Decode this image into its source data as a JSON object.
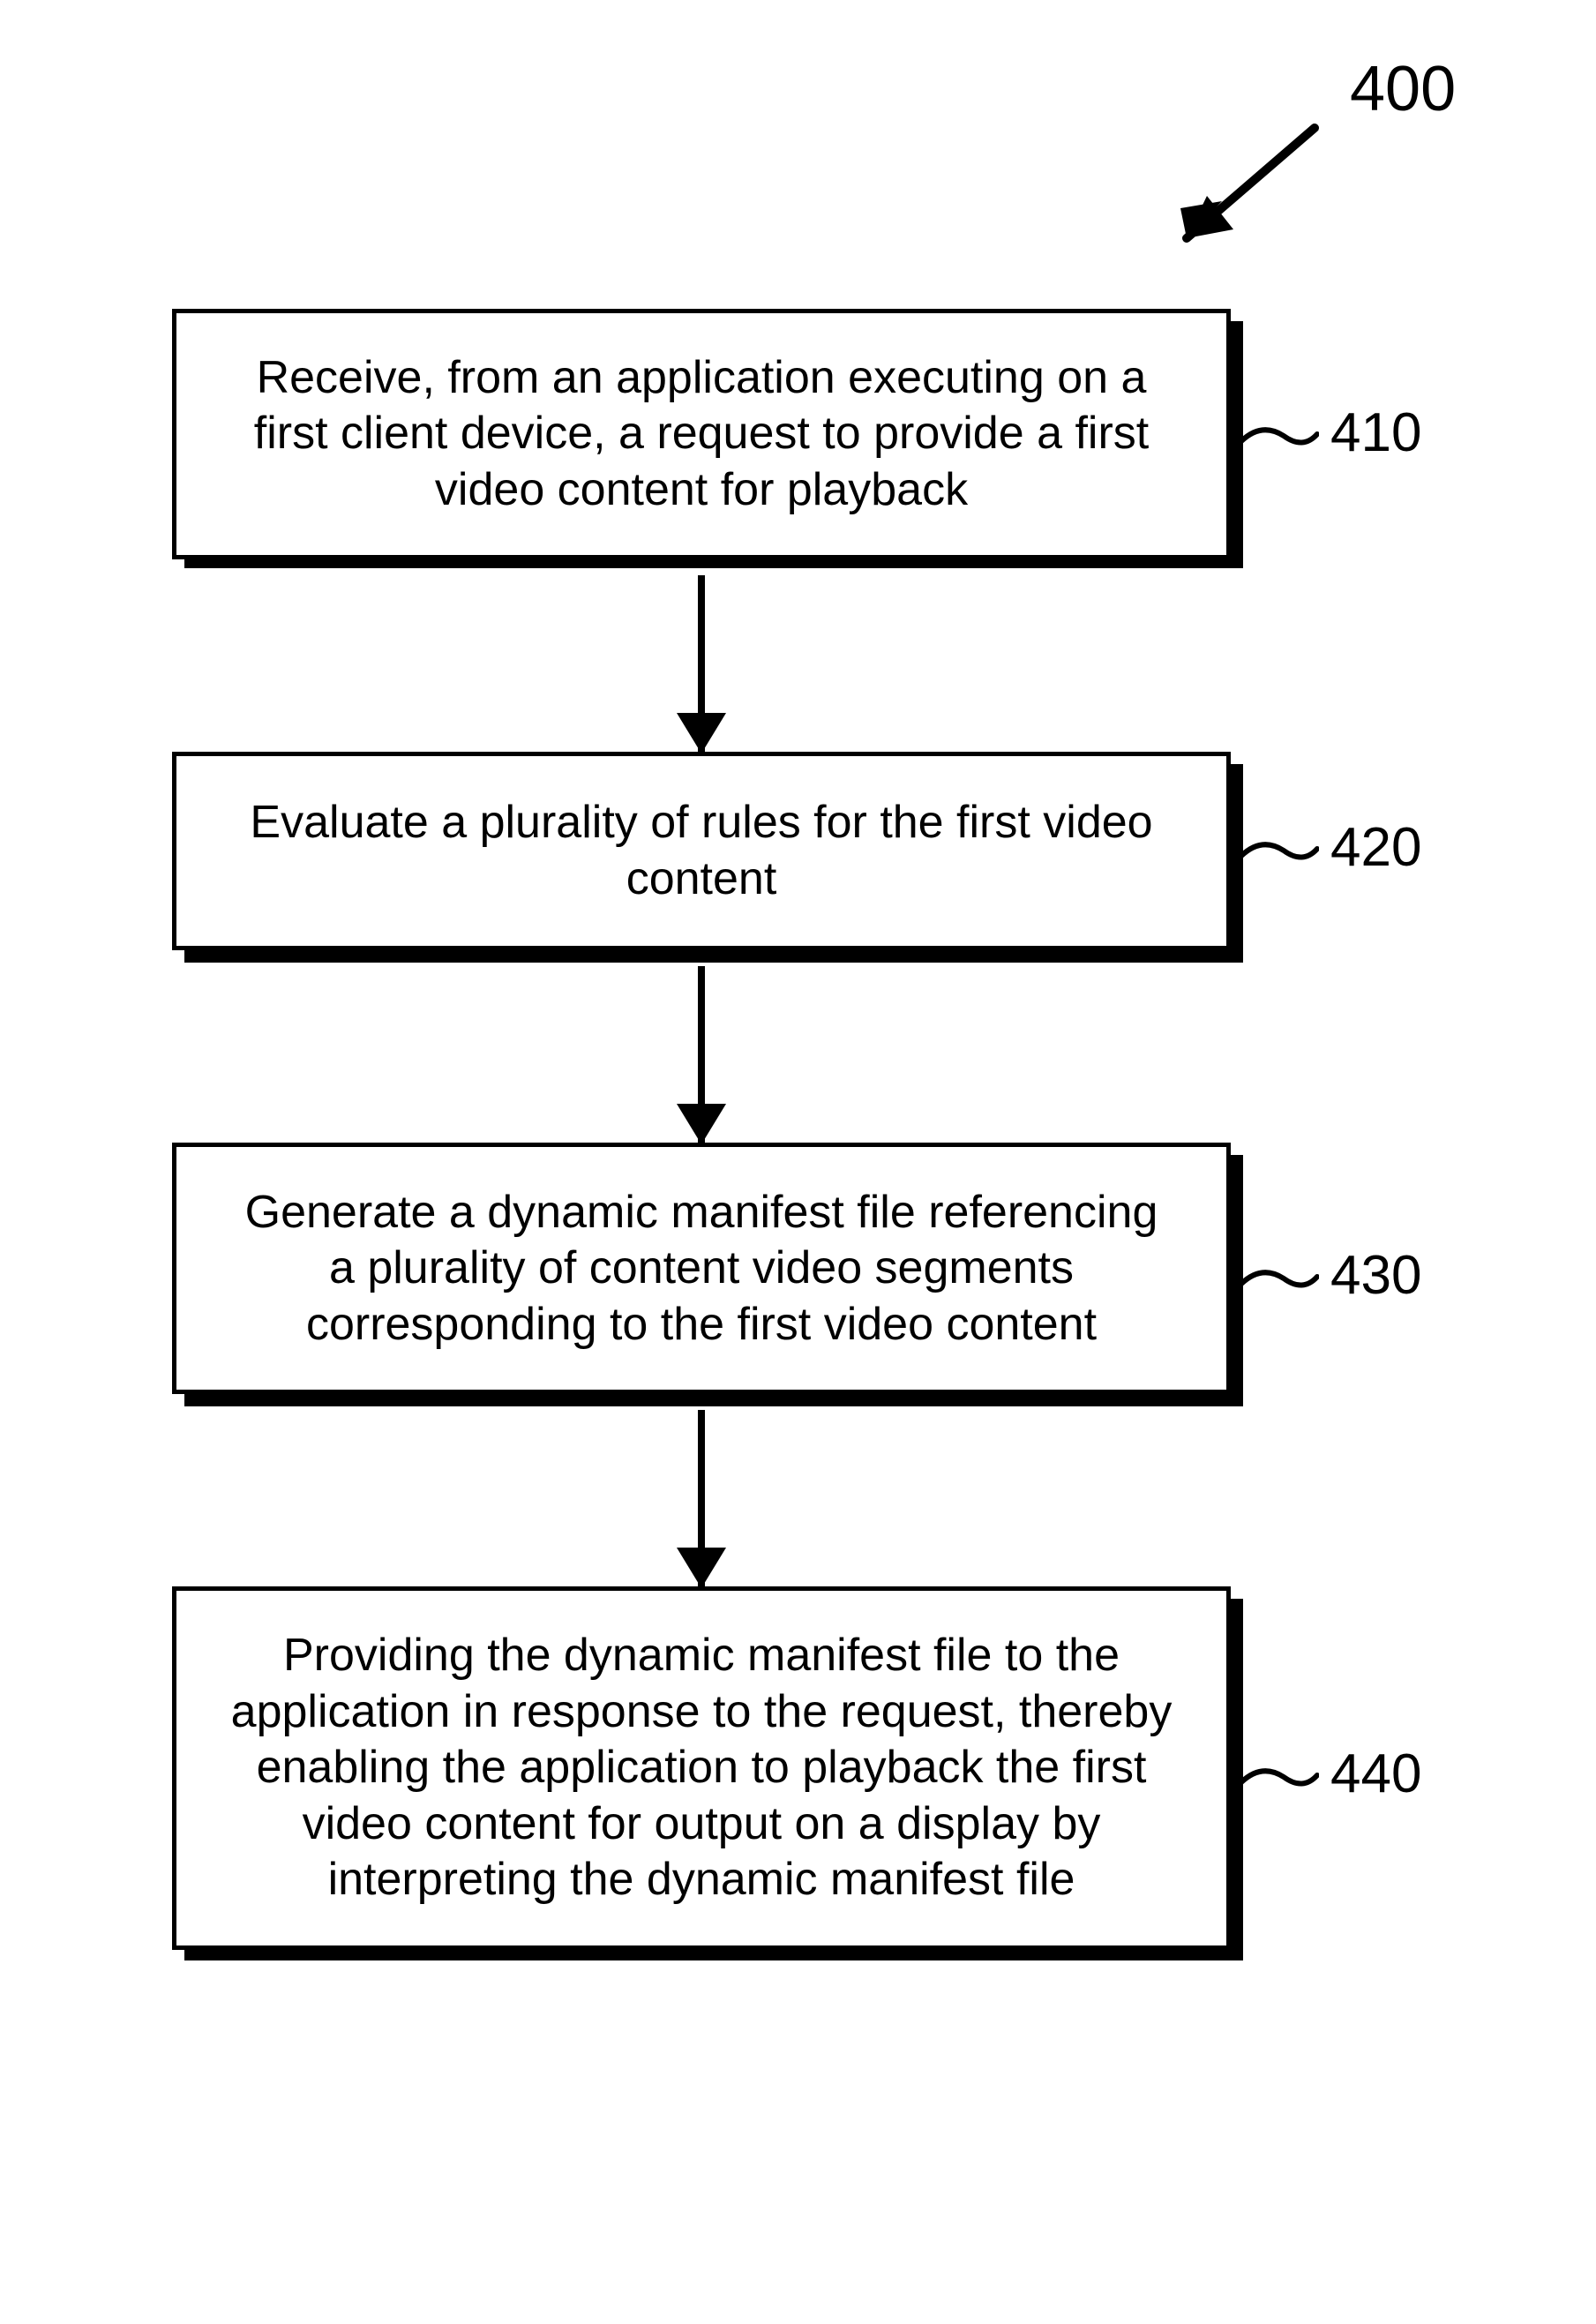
{
  "figure": {
    "number_label": "400"
  },
  "steps": [
    {
      "label": "410",
      "text": "Receive, from an application executing on a first client device, a request to provide a first video content for playback"
    },
    {
      "label": "420",
      "text": "Evaluate a plurality of rules for the first video content"
    },
    {
      "label": "430",
      "text": "Generate a dynamic manifest file referencing a plurality of content video segments corresponding to the first video content"
    },
    {
      "label": "440",
      "text": "Providing the dynamic manifest file to the application in response to the request, thereby enabling the application to playback the first video content for output on a display by interpreting the dynamic manifest file"
    }
  ]
}
